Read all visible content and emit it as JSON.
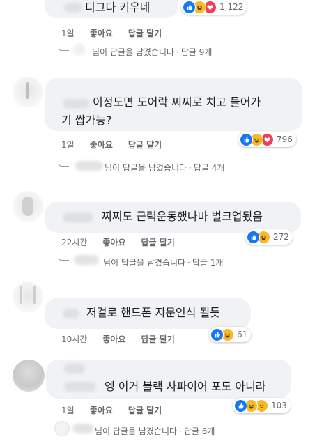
{
  "comments": [
    {
      "text": "디그다 키우네",
      "time": "1일",
      "like_label": "좋아요",
      "reply_label": "답글 달기",
      "reaction_count": "1,122",
      "reply_summary": "님이 답글을 남겼습니다",
      "reply_count": "답글 9개"
    },
    {
      "text_line1": "이정도면 도어락 찌찌로 치고 들어가",
      "text_line2": "기 쌉가능?",
      "time": "1일",
      "like_label": "좋아요",
      "reply_label": "답글 달기",
      "reaction_count": "796",
      "reply_summary": "님이 답글을 남겼습니다",
      "reply_count": "답글 4개"
    },
    {
      "text": "찌찌도 근력운동했나바 벌크업됬음",
      "time": "22시간",
      "like_label": "좋아요",
      "reply_label": "답글 달기",
      "reaction_count": "272",
      "reply_summary": "님이 답글을 남겼습니다",
      "reply_count": "답글 1개"
    },
    {
      "text": "저걸로 핸드폰 지문인식 될듯",
      "time": "10시간",
      "like_label": "좋아요",
      "reply_label": "답글 달기",
      "reaction_count": "61"
    },
    {
      "text": "엥 이거 블랙 사파이어 포도 아니라",
      "time": "1일",
      "like_label": "좋아요",
      "reply_label": "답글 달기",
      "reaction_count": "103",
      "reply_summary": "님이 답글을 남겼습니다",
      "reply_count": "답글 6개"
    }
  ],
  "dot": "·",
  "colors": {
    "like": "#1877f2",
    "haha": "#f7b928",
    "love": "#f33e58",
    "bubble": "#f0f2f5",
    "meta": "#65676b"
  },
  "reaction_icons": [
    "like-icon",
    "haha-icon",
    "love-icon",
    "sad-icon"
  ]
}
